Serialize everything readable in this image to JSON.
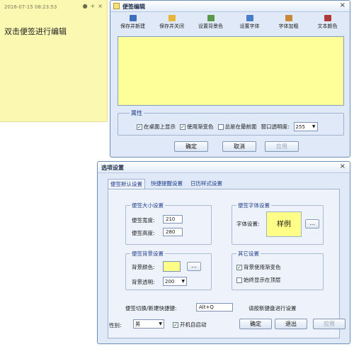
{
  "note": {
    "timestamp": "2016-07-15 08:23:53",
    "controls": [
      "●",
      "+",
      "×"
    ],
    "text": "双击便签进行编辑",
    "bg_color": "#fbf8b2"
  },
  "editor": {
    "title": "便签编辑",
    "close": "×",
    "toolbar": [
      {
        "icon": "save-new-icon",
        "label": "保存并新建",
        "color": "#3d6fbf"
      },
      {
        "icon": "save-close-icon",
        "label": "保存并关闭",
        "color": "#e4b63a"
      },
      {
        "icon": "background-icon",
        "label": "设置背景色",
        "color": "#5b9a4d"
      },
      {
        "icon": "font-icon",
        "label": "设置字体",
        "color": "#4a7fc8"
      },
      {
        "icon": "bold-icon",
        "label": "字体加粗",
        "color": "#c88a3a"
      },
      {
        "icon": "text-color-icon",
        "label": "文本颜色",
        "color": "#b03a3a"
      }
    ],
    "content_bg": "#ffff99",
    "attributes": {
      "title": "属性",
      "show_on_desktop": "在桌面上显示",
      "use_gradient": "使用渐变色",
      "always_on_top": "总是在最前面",
      "opacity_label": "窗口透明度:",
      "opacity_value": "255"
    },
    "buttons": {
      "ok": "确定",
      "cancel": "取消",
      "apply": "应用"
    }
  },
  "options": {
    "title": "选项设置",
    "close": "×",
    "tabs": [
      "便签默认设置",
      "快捷提醒设置",
      "日历样式设置"
    ],
    "size_group": {
      "title": "便签大小设置",
      "width_label": "便签宽度:",
      "width_value": "210",
      "height_label": "便签高度:",
      "height_value": "280"
    },
    "font_group": {
      "title": "便签字体设置",
      "font_label": "字体设置:",
      "preview": "样例",
      "browse": "..."
    },
    "bg_group": {
      "title": "便签背景设置",
      "color_label": "背景颜色:",
      "browse": "...",
      "opacity_label": "背景透明:",
      "opacity_value": "200",
      "swatch_color": "#ffff88"
    },
    "other_group": {
      "title": "其它设置",
      "gradient_label": "背景使用渐变色",
      "ontop_label": "始终显示在顶层"
    },
    "hotkey": {
      "label": "便签切换/新建快捷键:",
      "value": "Alt+Q",
      "hint": "请按新键盘进行设置"
    },
    "skin": {
      "label": "性别:",
      "value": "男"
    },
    "autostart_label": "开机自启动",
    "buttons": {
      "ok": "确定",
      "exit": "退出",
      "apply": "应用"
    }
  }
}
